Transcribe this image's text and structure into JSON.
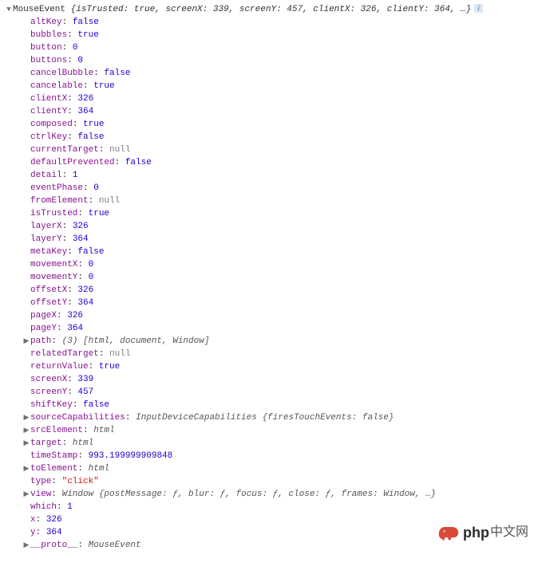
{
  "header": {
    "class": "MouseEvent",
    "summary": "{isTrusted: true, screenX: 339, screenY: 457, clientX: 326, clientY: 364, …}"
  },
  "props": [
    {
      "k": "altKey",
      "t": "bool",
      "v": "false"
    },
    {
      "k": "bubbles",
      "t": "bool",
      "v": "true"
    },
    {
      "k": "button",
      "t": "num",
      "v": "0"
    },
    {
      "k": "buttons",
      "t": "num",
      "v": "0"
    },
    {
      "k": "cancelBubble",
      "t": "bool",
      "v": "false"
    },
    {
      "k": "cancelable",
      "t": "bool",
      "v": "true"
    },
    {
      "k": "clientX",
      "t": "num",
      "v": "326"
    },
    {
      "k": "clientY",
      "t": "num",
      "v": "364"
    },
    {
      "k": "composed",
      "t": "bool",
      "v": "true"
    },
    {
      "k": "ctrlKey",
      "t": "bool",
      "v": "false"
    },
    {
      "k": "currentTarget",
      "t": "null",
      "v": "null"
    },
    {
      "k": "defaultPrevented",
      "t": "bool",
      "v": "false"
    },
    {
      "k": "detail",
      "t": "num",
      "v": "1"
    },
    {
      "k": "eventPhase",
      "t": "num",
      "v": "0"
    },
    {
      "k": "fromElement",
      "t": "null",
      "v": "null"
    },
    {
      "k": "isTrusted",
      "t": "bool",
      "v": "true"
    },
    {
      "k": "layerX",
      "t": "num",
      "v": "326"
    },
    {
      "k": "layerY",
      "t": "num",
      "v": "364"
    },
    {
      "k": "metaKey",
      "t": "bool",
      "v": "false"
    },
    {
      "k": "movementX",
      "t": "num",
      "v": "0"
    },
    {
      "k": "movementY",
      "t": "num",
      "v": "0"
    },
    {
      "k": "offsetX",
      "t": "num",
      "v": "326"
    },
    {
      "k": "offsetY",
      "t": "num",
      "v": "364"
    },
    {
      "k": "pageX",
      "t": "num",
      "v": "326"
    },
    {
      "k": "pageY",
      "t": "num",
      "v": "364"
    },
    {
      "k": "path",
      "t": "exp",
      "v": "(3) [html, document, Window]"
    },
    {
      "k": "relatedTarget",
      "t": "null",
      "v": "null"
    },
    {
      "k": "returnValue",
      "t": "bool",
      "v": "true"
    },
    {
      "k": "screenX",
      "t": "num",
      "v": "339"
    },
    {
      "k": "screenY",
      "t": "num",
      "v": "457"
    },
    {
      "k": "shiftKey",
      "t": "bool",
      "v": "false"
    },
    {
      "k": "sourceCapabilities",
      "t": "exp",
      "v": "InputDeviceCapabilities {firesTouchEvents: false}"
    },
    {
      "k": "srcElement",
      "t": "exp",
      "v": "html"
    },
    {
      "k": "target",
      "t": "exp",
      "v": "html"
    },
    {
      "k": "timeStamp",
      "t": "num",
      "v": "993.199999909848"
    },
    {
      "k": "toElement",
      "t": "exp",
      "v": "html"
    },
    {
      "k": "type",
      "t": "str",
      "v": "\"click\""
    },
    {
      "k": "view",
      "t": "exp",
      "v": "Window {postMessage: ƒ, blur: ƒ, focus: ƒ, close: ƒ, frames: Window, …}"
    },
    {
      "k": "which",
      "t": "num",
      "v": "1"
    },
    {
      "k": "x",
      "t": "num",
      "v": "326"
    },
    {
      "k": "y",
      "t": "num",
      "v": "364"
    },
    {
      "k": "__proto__",
      "t": "exp",
      "v": "MouseEvent"
    }
  ],
  "watermark": {
    "label": "php",
    "cn": "中文网"
  }
}
